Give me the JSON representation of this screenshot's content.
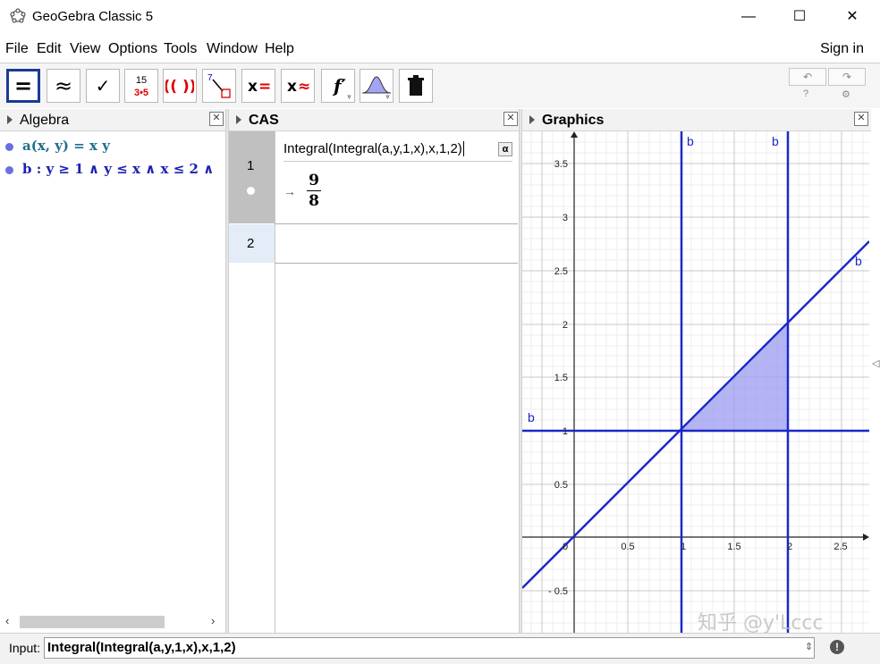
{
  "window": {
    "title": "GeoGebra Classic 5",
    "minimize": "—",
    "maximize": "☐",
    "close": "✕"
  },
  "menu": [
    "File",
    "Edit",
    "View",
    "Options",
    "Tools",
    "Window",
    "Help"
  ],
  "sign_in": "Sign in",
  "toolbar": {
    "tools": [
      {
        "name": "evaluate-tool",
        "label": "="
      },
      {
        "name": "numeric-tool",
        "label": "≈"
      },
      {
        "name": "keep-input-tool",
        "label": "✓"
      },
      {
        "name": "factor-tool",
        "label": "15 / 3•5"
      },
      {
        "name": "expand-tool",
        "label": "(( ))"
      },
      {
        "name": "substitute-tool",
        "label": "7→"
      },
      {
        "name": "solve-tool",
        "label": "x="
      },
      {
        "name": "solve-numerically-tool",
        "label": "x≈"
      },
      {
        "name": "derivative-tool",
        "label": "f′"
      },
      {
        "name": "probability-calculator-tool",
        "label": "bell"
      },
      {
        "name": "delete-tool",
        "label": "trash"
      }
    ]
  },
  "algebra": {
    "title": "Algebra",
    "items": [
      {
        "text": "a(x, y)  =  x y",
        "color": "#1f6e8c"
      },
      {
        "text": "b : y ≥ 1 ∧ y ≤ x ∧ x ≤ 2 ∧",
        "color": "#1c1fb0"
      }
    ]
  },
  "cas": {
    "title": "CAS",
    "rows": [
      {
        "num": "1",
        "input": "Integral(Integral(a,y,1,x),x,1,2)",
        "output_num": "9",
        "output_den": "8",
        "arrow": "→"
      },
      {
        "num": "2",
        "input": ""
      }
    ],
    "alpha_button": "α"
  },
  "graphics": {
    "title": "Graphics",
    "x_ticks": [
      "0",
      "0.5",
      "1",
      "1.5",
      "2",
      "2.5"
    ],
    "y_ticks": [
      "3.5",
      "3",
      "2.5",
      "2",
      "1.5",
      "1",
      "0.5",
      "- 0.5"
    ],
    "labels": [
      "b",
      "b",
      "b",
      "b"
    ],
    "region_color": "#9b9bf0",
    "line_color": "#1c28c8",
    "watermark": "知乎 @y'Lccc"
  },
  "inputbar": {
    "label": "Input:",
    "value": "Integral(Integral(a,y,1,x),x,1,2)"
  }
}
